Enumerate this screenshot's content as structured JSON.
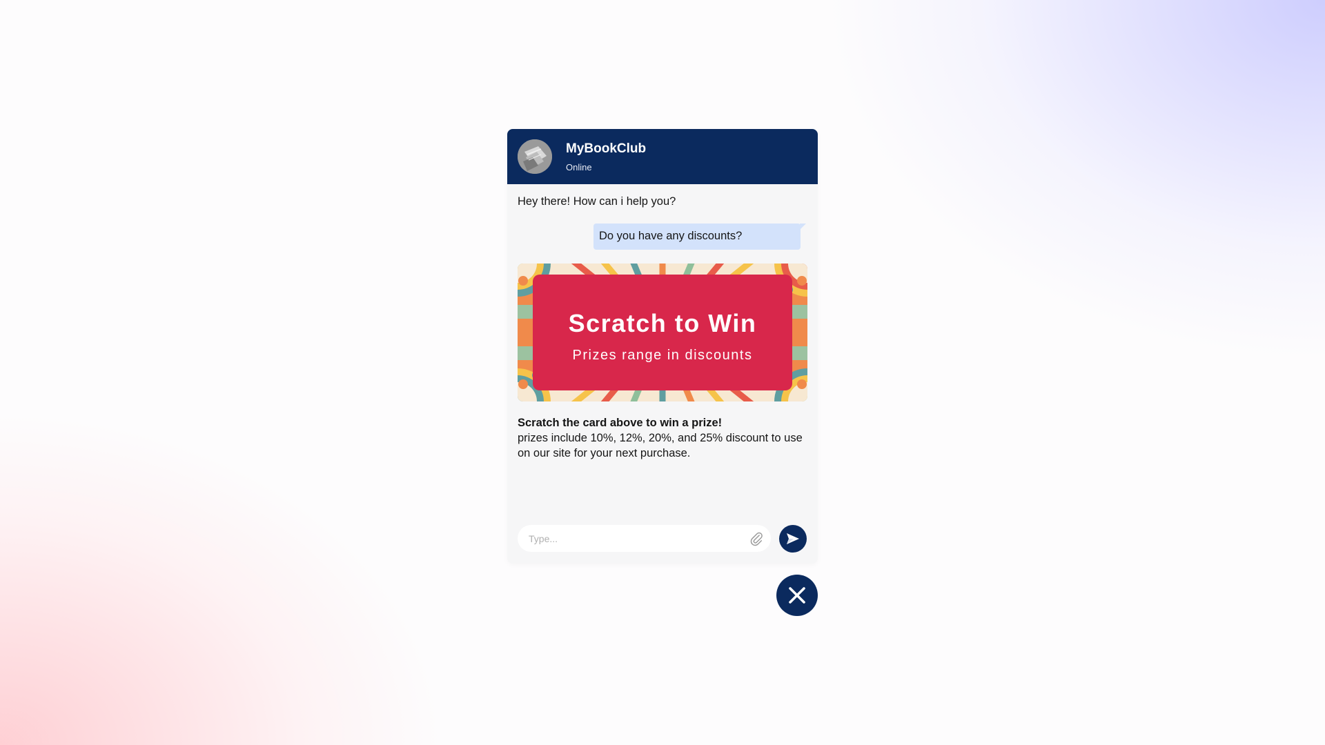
{
  "chat": {
    "title": "MyBookClub",
    "status": "Online",
    "avatar_icon": "book-avatar",
    "messages": [
      {
        "from": "bot",
        "text": "Hey there! How can i help you?"
      },
      {
        "from": "user",
        "text": "Do you have any discounts?"
      }
    ],
    "promo_card": {
      "title": "Scratch to Win",
      "subtitle": "Prizes range in discounts"
    },
    "info": {
      "headline": "Scratch the card above to win a prize!",
      "body": "prizes include 10%, 12%, 20%, and 25% discount to use on our site for your next purchase."
    },
    "input": {
      "placeholder": "Type...",
      "attach_icon": "paperclip-icon",
      "send_icon": "send-icon"
    }
  },
  "close_button": {
    "icon": "close-icon"
  },
  "colors": {
    "header": "#0b2a5e",
    "user_bubble": "#d3e2fb",
    "card_red": "#d8274b",
    "panel_bg": "#f6f6f7"
  }
}
